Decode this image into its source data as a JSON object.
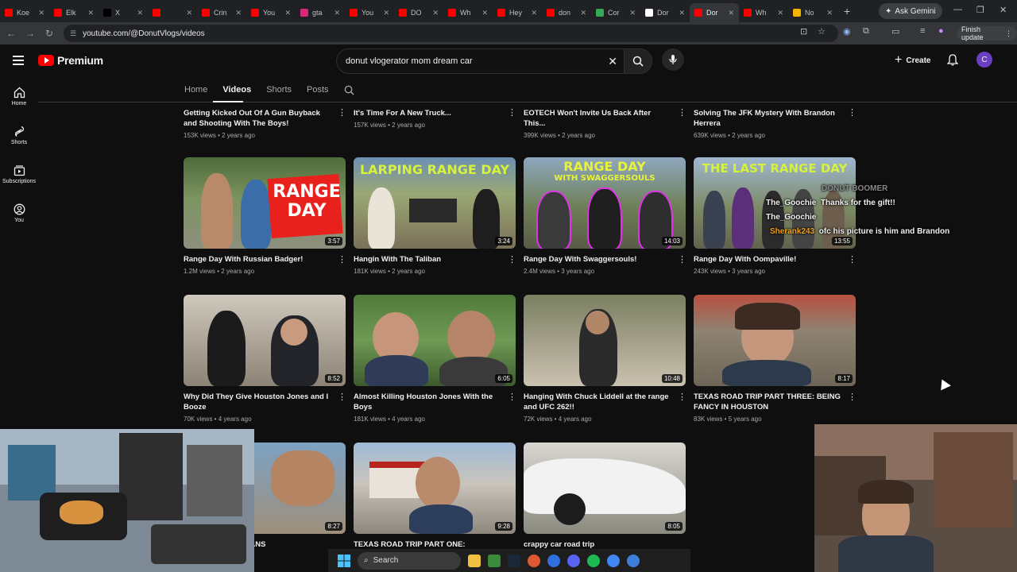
{
  "browser": {
    "tabs": [
      {
        "label": "Koe",
        "color": "#ff0000"
      },
      {
        "label": "Elk",
        "color": "#ff0000"
      },
      {
        "label": "X",
        "color": "#000000"
      },
      {
        "label": "",
        "color": "#ff0000"
      },
      {
        "label": "Crin",
        "color": "#ff0000"
      },
      {
        "label": "You",
        "color": "#ff0000"
      },
      {
        "label": "gta",
        "color": "#d62976"
      },
      {
        "label": "You",
        "color": "#ff0000"
      },
      {
        "label": "DO",
        "color": "#ff0000"
      },
      {
        "label": "Wh",
        "color": "#ff0000"
      },
      {
        "label": "Hey",
        "color": "#ff0000"
      },
      {
        "label": "don",
        "color": "#ff0000"
      },
      {
        "label": "Cor",
        "color": "#34a853"
      },
      {
        "label": "Dor",
        "color": "#ffffff"
      },
      {
        "label": "Dor",
        "color": "#ff0000",
        "active": true
      },
      {
        "label": "Wh",
        "color": "#ff0000"
      },
      {
        "label": "No",
        "color": "#f4b400"
      }
    ],
    "new_tab": "+",
    "ask_gemini": "Ask Gemini",
    "url": "youtube.com/@DonutVlogs/videos",
    "finish_update": "Finish update"
  },
  "yt": {
    "brand": "Premium",
    "search_value": "donut vlogerator mom dream car",
    "create_label": "Create",
    "avatar_letter": "C",
    "guide": {
      "home": "Home",
      "shorts": "Shorts",
      "subscriptions": "Subscriptions",
      "you": "You"
    },
    "channel_tabs": [
      "Home",
      "Videos",
      "Shorts",
      "Posts"
    ]
  },
  "videos": {
    "row0": [
      {
        "title": "Getting Kicked Out Of A Gun Buyback and Shooting With The Boys!",
        "meta": "153K views • 2 years ago"
      },
      {
        "title": "It's Time For A New Truck...",
        "meta": "157K views • 2 years ago"
      },
      {
        "title": "EOTECH Won't Invite Us Back After This...",
        "meta": "399K views • 2 years ago"
      },
      {
        "title": "Solving The JFK Mystery With Brandon Herrera",
        "meta": "639K views • 2 years ago"
      }
    ],
    "row1": [
      {
        "title": "Range Day With Russian Badger!",
        "meta": "1.2M views • 2 years ago",
        "duration": "3:57",
        "overlay": "RANGE DAY"
      },
      {
        "title": "Hangin With The Taliban",
        "meta": "181K views • 2 years ago",
        "duration": "3:24",
        "overlay": "LARPING RANGE DAY"
      },
      {
        "title": "Range Day With Swaggersouls!",
        "meta": "2.4M views • 3 years ago",
        "duration": "14:03",
        "overlay": "RANGE DAY",
        "overlay2": "WITH SWAGGERSOULS"
      },
      {
        "title": "Range Day With Oompaville!",
        "meta": "243K views • 3 years ago",
        "duration": "13:55",
        "overlay": "THE LAST RANGE DAY"
      }
    ],
    "row2": [
      {
        "title": "Why Did They Give Houston Jones and I Booze",
        "meta": "70K views • 4 years ago",
        "duration": "8:52"
      },
      {
        "title": "Almost Killing Houston Jones With the Boys",
        "meta": "181K views • 4 years ago",
        "duration": "6:05"
      },
      {
        "title": "Hanging With Chuck Liddell at the range and UFC 262!!",
        "meta": "72K views • 4 years ago",
        "duration": "10:48"
      },
      {
        "title": "TEXAS ROAD TRIP PART THREE: BEING FANCY IN HOUSTON",
        "meta": "83K views • 5 years ago",
        "duration": "8:17"
      }
    ],
    "row3": [
      {
        "title": "ART TWO: NORLEANS",
        "duration": "8:27"
      },
      {
        "title": "TEXAS ROAD TRIP PART ONE: Spaghetti",
        "duration": "9:28"
      },
      {
        "title": "crappy car road trip",
        "duration": "8:05"
      }
    ]
  },
  "chat": {
    "header": "DONUT BOOMER",
    "lines": [
      {
        "user": "The_Goochie",
        "text": "Thanks for the gift!!",
        "color": "#e6e6e6"
      },
      {
        "user": "The_Goochie",
        "text": "",
        "color": "#e6e6e6"
      },
      {
        "user": "Sherank243",
        "text": "ofc his picture is him and Brandon",
        "color": "#f0a21c"
      }
    ]
  },
  "taskbar": {
    "search": "Search"
  },
  "colors": {
    "bg": "#0f0f0f",
    "accent_red": "#ff0000",
    "avatar": "#6a3fc1"
  }
}
